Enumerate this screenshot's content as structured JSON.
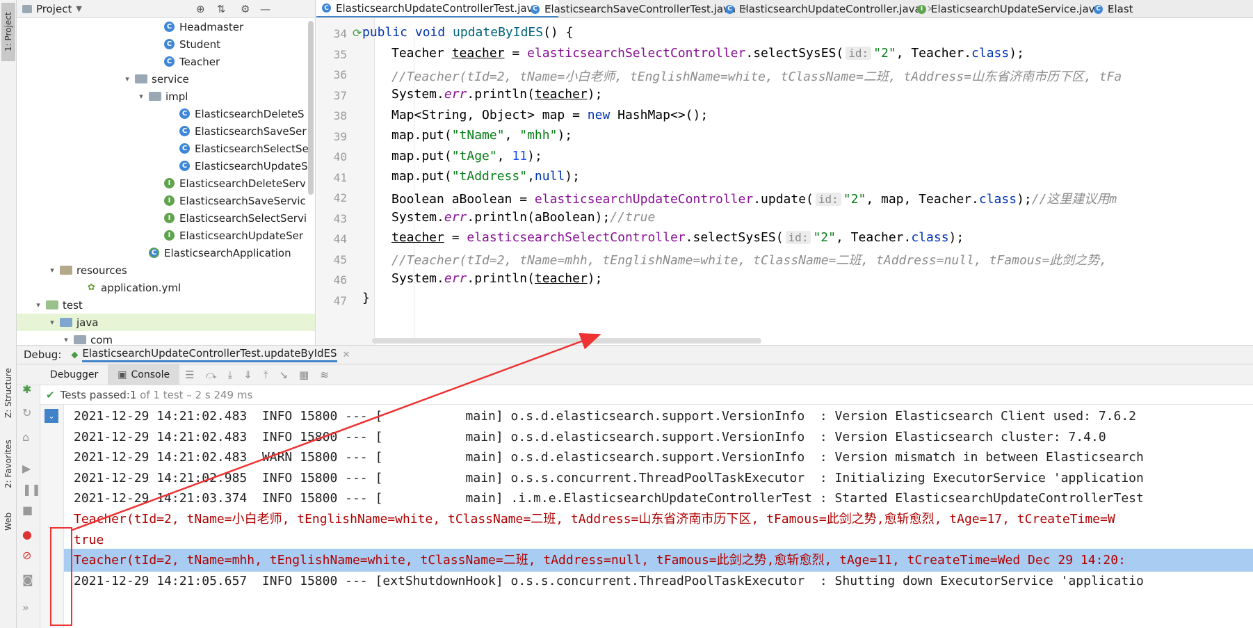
{
  "left_strip": {
    "project": "1: Project",
    "structure": "Z: Structure",
    "favorites": "2: Favorites",
    "web": "Web"
  },
  "project_panel": {
    "title": "Project",
    "tree": [
      {
        "label": "Headmaster",
        "kind": "class"
      },
      {
        "label": "Student",
        "kind": "class"
      },
      {
        "label": "Teacher",
        "kind": "class"
      },
      {
        "label": "service",
        "kind": "folder"
      },
      {
        "label": "impl",
        "kind": "folder"
      },
      {
        "label": "ElasticsearchDeleteS",
        "kind": "class"
      },
      {
        "label": "ElasticsearchSaveSer",
        "kind": "class"
      },
      {
        "label": "ElasticsearchSelectSe",
        "kind": "class"
      },
      {
        "label": "ElasticsearchUpdateS",
        "kind": "class"
      },
      {
        "label": "ElasticsearchDeleteServ",
        "kind": "interface"
      },
      {
        "label": "ElasticsearchSaveServic",
        "kind": "interface"
      },
      {
        "label": "ElasticsearchSelectServi",
        "kind": "interface"
      },
      {
        "label": "ElasticsearchUpdateSer",
        "kind": "interface"
      },
      {
        "label": "ElasticsearchApplication",
        "kind": "spring"
      },
      {
        "label": "resources",
        "kind": "folder"
      },
      {
        "label": "application.yml",
        "kind": "yml"
      },
      {
        "label": "test",
        "kind": "folder"
      },
      {
        "label": "java",
        "kind": "folder"
      },
      {
        "label": "com",
        "kind": "folder"
      }
    ]
  },
  "editor_tabs": [
    {
      "label": "ElasticsearchUpdateControllerTest.java"
    },
    {
      "label": "ElasticsearchSaveControllerTest.java"
    },
    {
      "label": "ElasticsearchUpdateController.java"
    },
    {
      "label": "ElasticsearchUpdateService.java"
    },
    {
      "label": "Elast"
    }
  ],
  "editor": {
    "line_numbers": [
      "34",
      "35",
      "36",
      "37",
      "38",
      "39",
      "40",
      "41",
      "42",
      "43",
      "44",
      "45",
      "46",
      "47"
    ],
    "line35": {
      "t1": "Teacher ",
      "t2": "teacher",
      "t3": " = ",
      "t4": "elasticsearchSelectController",
      "t5": ".selectSysES(",
      "hint": "id:",
      "t6": "\"2\"",
      "t7": ", Teacher.",
      "t8": "class",
      "t9": ");"
    },
    "line36": "//Teacher(tId=2, tName=小白老师, tEnglishName=white, tClassName=二班, tAddress=山东省济南市历下区, tFa",
    "line37": {
      "t1": "System.",
      "t2": "err",
      "t3": ".println(",
      "t4": "teacher",
      "t5": ");"
    },
    "line38": {
      "t1": "Map<String, Object> map = ",
      "t2": "new",
      "t3": " HashMap<>();"
    },
    "line39": {
      "t1": "map.put(",
      "t2": "\"tName\"",
      "t3": ", ",
      "t4": "\"mhh\"",
      "t5": ");"
    },
    "line40": {
      "t1": "map.put(",
      "t2": "\"tAge\"",
      "t3": ", ",
      "t4": "11",
      "t5": ");"
    },
    "line41": {
      "t1": "map.put(",
      "t2": "\"tAddress\"",
      "t3": ",",
      "t4": "null",
      "t5": ");"
    },
    "line42": {
      "t1": "Boolean aBoolean = ",
      "t2": "elasticsearchUpdateController",
      "t3": ".update(",
      "hint": "id:",
      "t4": "\"2\"",
      "t5": ", map, Teacher.",
      "t6": "class",
      "t7": ");",
      "t8": "//这里建议用m"
    },
    "line43": {
      "t1": "System.",
      "t2": "err",
      "t3": ".println(aBoolean);",
      "t4": "//true"
    },
    "line44": {
      "t1": "teacher",
      "t2": " = ",
      "t3": "elasticsearchSelectController",
      "t4": ".selectSysES(",
      "hint": "id:",
      "t5": "\"2\"",
      "t6": ", Teacher.",
      "t7": "class",
      "t8": ");"
    },
    "line45": "//Teacher(tId=2, tName=mhh, tEnglishName=white, tClassName=二班, tAddress=null, tFamous=此剑之势,",
    "line46": {
      "t1": "System.",
      "t2": "err",
      "t3": ".println(",
      "t4": "teacher",
      "t5": ");"
    },
    "line33": "public void updateByIdES() {",
    "line47": "}"
  },
  "debug": {
    "label": "Debug:",
    "session_tab": "ElasticsearchUpdateControllerTest.updateByIdES",
    "debugger_tab": "Debugger",
    "console_tab": "Console",
    "status_prefix": "Tests passed: ",
    "status_count": "1",
    "status_rest": " of 1 test – 2 s 249 ms"
  },
  "console_lines": [
    "2021-12-29 14:21:02.483  INFO 15800 --- [           main] o.s.d.elasticsearch.support.VersionInfo  : Version Elasticsearch Client used: 7.6.2",
    "2021-12-29 14:21:02.483  INFO 15800 --- [           main] o.s.d.elasticsearch.support.VersionInfo  : Version Elasticsearch cluster: 7.4.0",
    "2021-12-29 14:21:02.483  WARN 15800 --- [           main] o.s.d.elasticsearch.support.VersionInfo  : Version mismatch in between Elasticsearch",
    "2021-12-29 14:21:02.985  INFO 15800 --- [           main] o.s.s.concurrent.ThreadPoolTaskExecutor  : Initializing ExecutorService 'application",
    "2021-12-29 14:21:03.374  INFO 15800 --- [           main] .i.m.e.ElasticsearchUpdateControllerTest : Started ElasticsearchUpdateControllerTest",
    "Teacher(tId=2, tName=小白老师, tEnglishName=white, tClassName=二班, tAddress=山东省济南市历下区, tFamous=此剑之势,愈斩愈烈, tAge=17, tCreateTime=W",
    "true",
    "Teacher(tId=2, tName=mhh, tEnglishName=white, tClassName=二班, tAddress=null, tFamous=此剑之势,愈斩愈烈, tAge=11, tCreateTime=Wed Dec 29 14:20:",
    "2021-12-29 14:21:05.657  INFO 15800 --- [extShutdownHook] o.s.s.concurrent.ThreadPoolTaskExecutor  : Shutting down ExecutorService 'applicatio"
  ],
  "colors": {
    "annotation_red": "#e33333",
    "selection": "#a9cdf2",
    "output_red": "#b00000"
  }
}
